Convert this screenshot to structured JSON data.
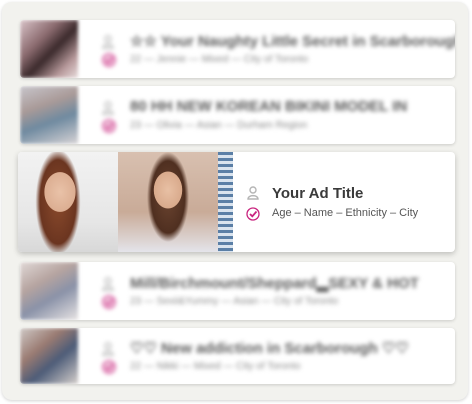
{
  "colors": {
    "accent_pink": "#c9247f",
    "icon_gray": "#b5b5b5",
    "frame_bg": "#f2f2ee"
  },
  "icons": {
    "person": "person-icon",
    "verified": "verified-check-icon"
  },
  "featured": {
    "title": "Your Ad Title",
    "meta": "Age – Name – Ethnicity – City"
  },
  "listings": [
    {
      "title": "☆☆ Your Naughty Little Secret in Scarborough",
      "meta": "22 — Jennie — Mixed — City of Toronto"
    },
    {
      "title": "80 HH NEW KOREAN BIKINI MODEL IN",
      "meta": "23 — Olivia — Asian — Durham Region"
    },
    {
      "title": "Mill/Birchmount/Sheppard▂SEXY & HOT",
      "meta": "23 — Sexii&Yummy — Asian — City of Toronto"
    },
    {
      "title": "♡♡ New addiction in Scarborough ♡♡",
      "meta": "22 — Nikki — Mixed — City of Toronto"
    }
  ]
}
